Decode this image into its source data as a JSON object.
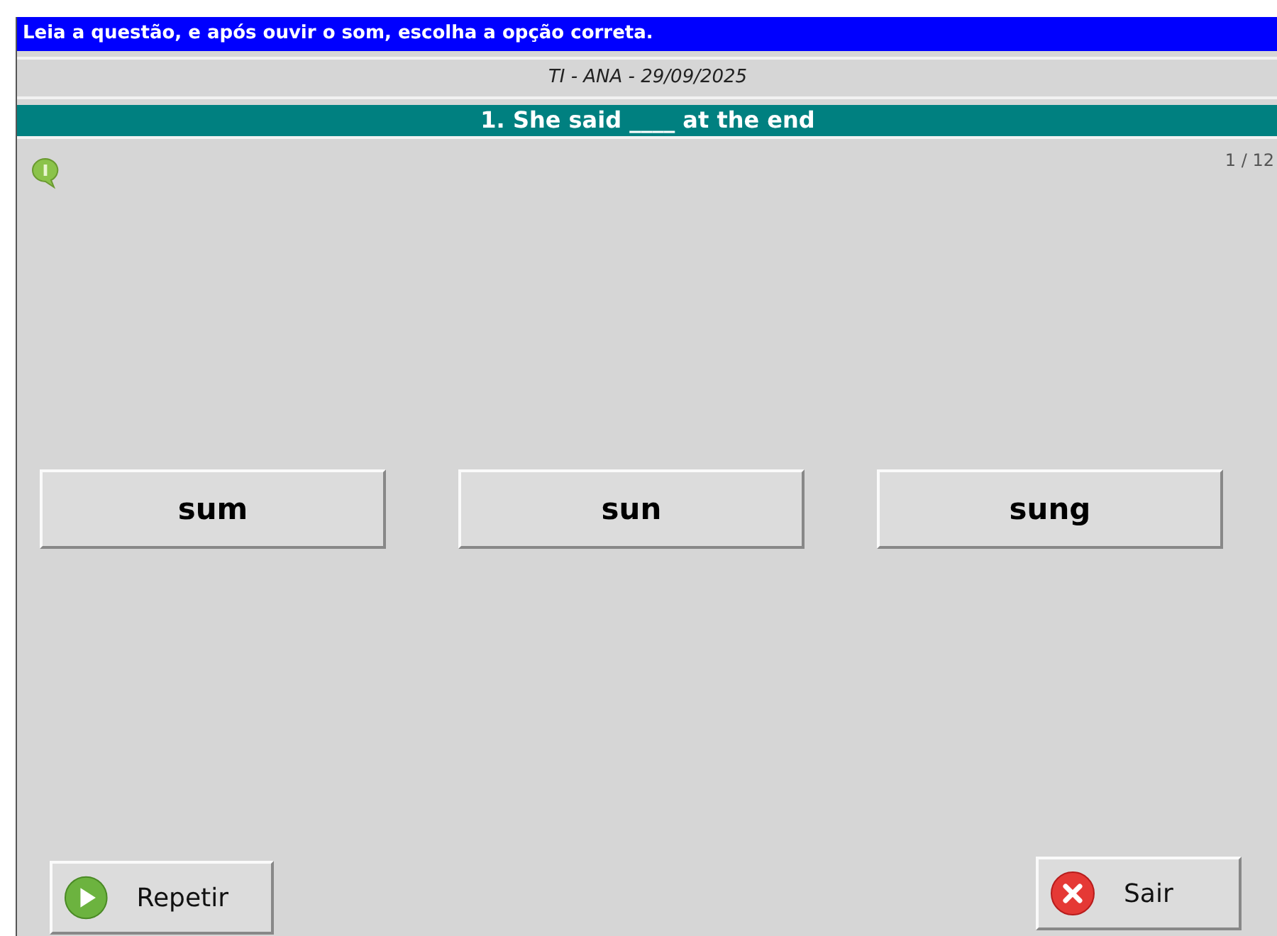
{
  "instruction": "Leia a questão, e após ouvir o som, escolha a opção correta.",
  "subtitle": "TI - ANA - 29/09/2025",
  "question": "1. She said ____ at the end",
  "counter": "1 / 12",
  "options": [
    "sum",
    "sun",
    "sung"
  ],
  "buttons": [
    {
      "kind": "repeat",
      "label": "Repetir"
    },
    {
      "kind": "exit",
      "label": "Sair"
    }
  ]
}
